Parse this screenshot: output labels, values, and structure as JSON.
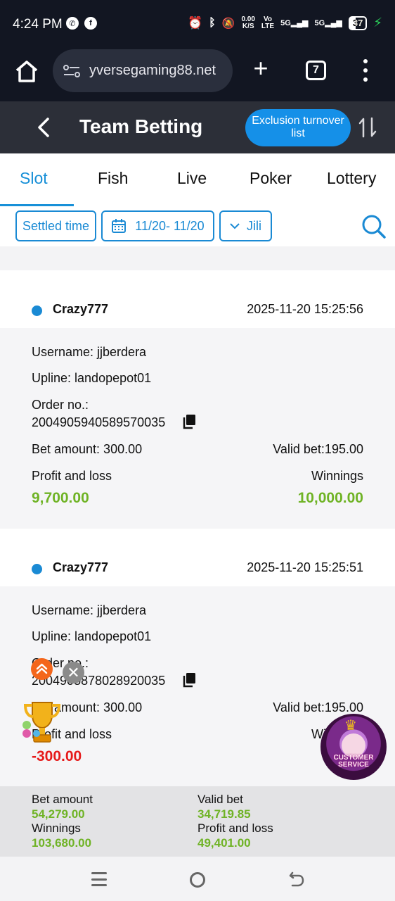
{
  "status_bar": {
    "time": "4:24 PM",
    "net_speed_top": "0.00",
    "net_speed_unit": "K/S",
    "volte_top": "Vo",
    "volte_bottom": "LTE",
    "sig1": "5G",
    "sig2": "5G",
    "battery": "37"
  },
  "browser": {
    "url": "yversegaming88.net",
    "tab_count": "7"
  },
  "header": {
    "title": "Team Betting",
    "exclusion_button": "Exclusion turnover list"
  },
  "tabs": [
    {
      "label": "Slot",
      "active": true
    },
    {
      "label": "Fish",
      "active": false
    },
    {
      "label": "Live",
      "active": false
    },
    {
      "label": "Poker",
      "active": false
    },
    {
      "label": "Lottery",
      "active": false
    }
  ],
  "filters": {
    "time_type": "Settled time",
    "date_range": "11/20- 11/20",
    "provider": "Jili"
  },
  "records": [
    {
      "game": "Crazy777",
      "datetime": "2025-11-20 15:25:56",
      "username": "Username: jjberdera",
      "upline": "Upline: landopepot01",
      "order_label": "Order no.:",
      "order_no": "2004905940589570035",
      "bet_amount": "Bet amount: 300.00",
      "valid_bet": "Valid bet:195.00",
      "pl_label": "Profit and loss",
      "pl_value": "9,700.00",
      "win_label": "Winnings",
      "win_value": "10,000.00"
    },
    {
      "game": "Crazy777",
      "datetime": "2025-11-20 15:25:51",
      "username": "Username: jjberdera",
      "upline": "Upline: landopepot01",
      "order_label": "Order no.:",
      "order_no": "2004905878028920035",
      "bet_amount": "Bet amount: 300.00",
      "valid_bet": "Valid bet:195.00",
      "pl_label": "Profit and loss",
      "pl_value": "-300.00",
      "win_label": "Winnings",
      "win_value": "-"
    }
  ],
  "summary": {
    "bet_amount_label": "Bet amount",
    "bet_amount": "54,279.00",
    "valid_bet_label": "Valid bet",
    "valid_bet": "34,719.85",
    "winnings_label": "Winnings",
    "winnings": "103,680.00",
    "pl_label": "Profit and loss",
    "pl": "49,401.00"
  },
  "floating": {
    "cs_label": "CUSTOMER SERVICE"
  },
  "colors": {
    "accent_blue": "#1590e8",
    "profit_green": "#6fb325",
    "loss_red": "#e61a1a"
  }
}
